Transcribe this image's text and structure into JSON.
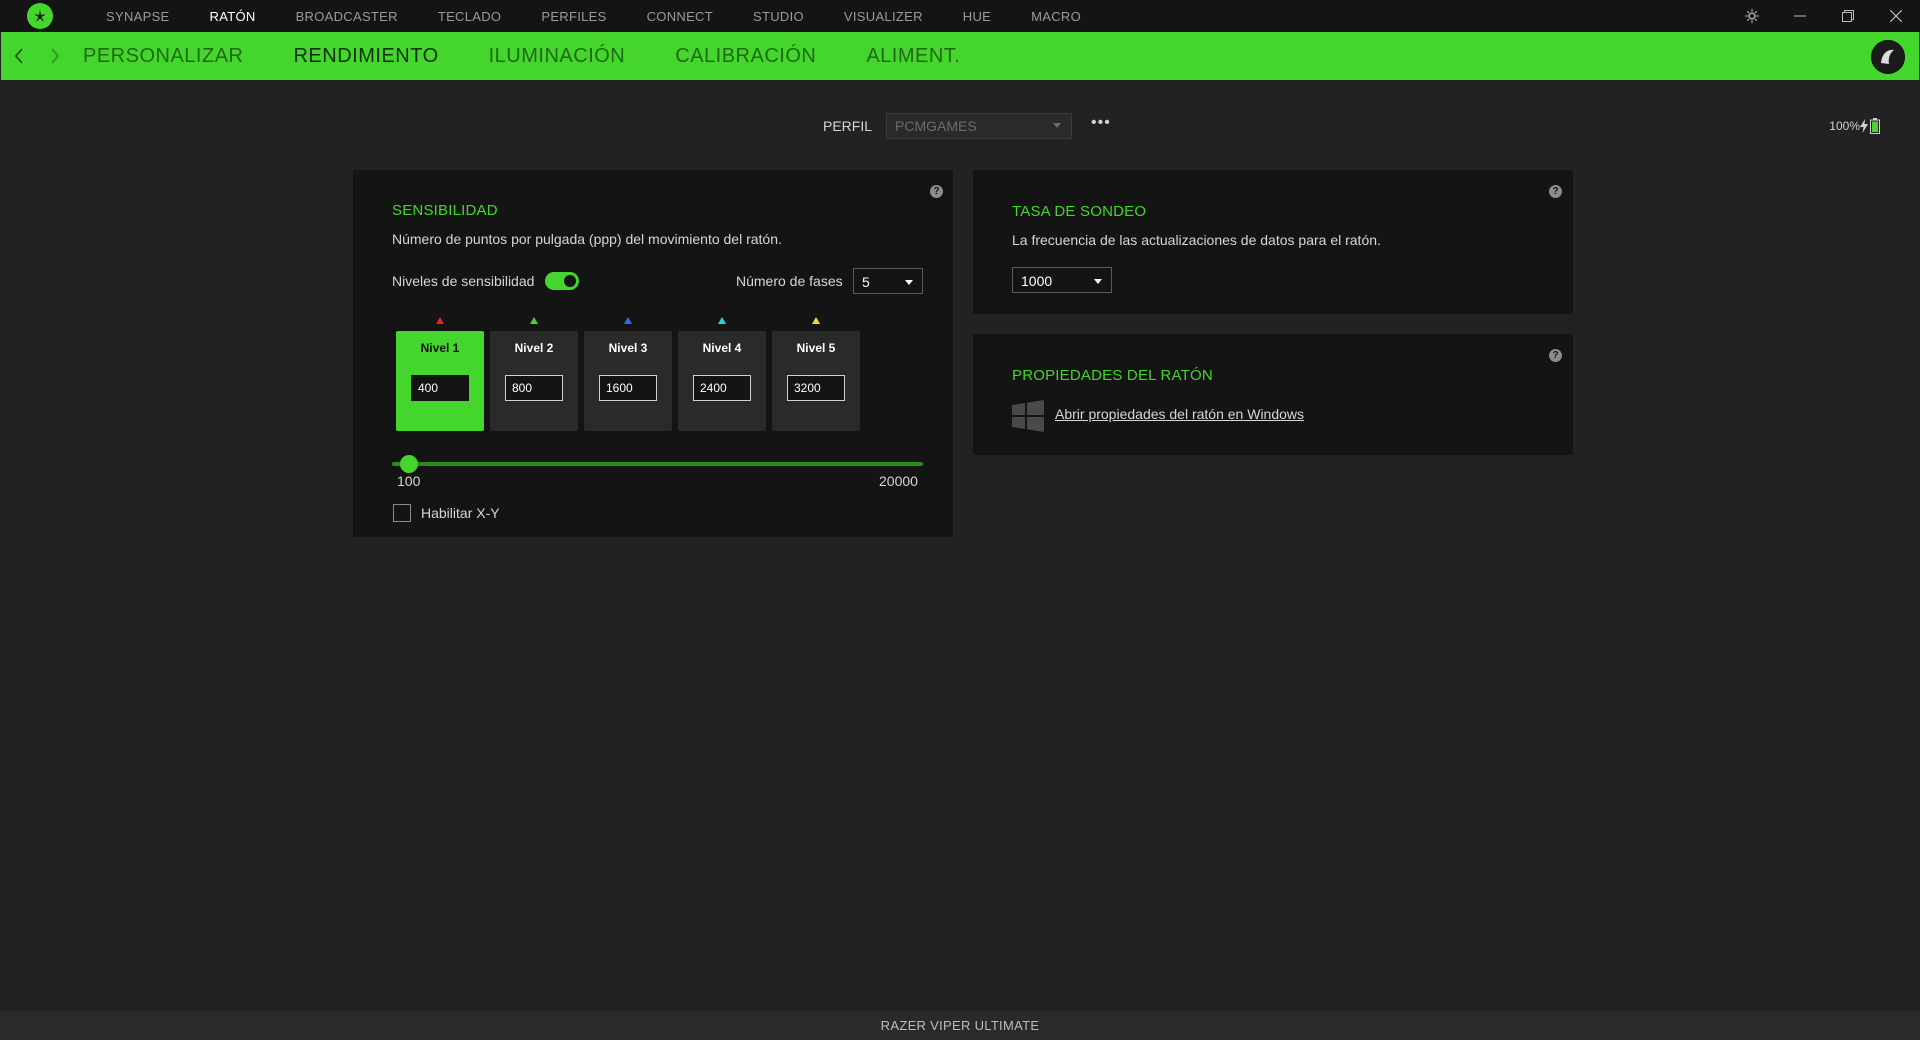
{
  "topnav": {
    "items": [
      "SYNAPSE",
      "RATÓN",
      "BROADCASTER",
      "TECLADO",
      "PERFILES",
      "CONNECT",
      "STUDIO",
      "VISUALIZER",
      "HUE",
      "MACRO"
    ],
    "active": "RATÓN"
  },
  "subnav": {
    "tabs": [
      "PERSONALIZAR",
      "RENDIMIENTO",
      "ILUMINACIÓN",
      "CALIBRACIÓN",
      "ALIMENT."
    ],
    "active": "RENDIMIENTO"
  },
  "profile": {
    "label": "PERFIL",
    "value": "PCMGAMES",
    "more": "•••"
  },
  "battery": {
    "text": "100%",
    "level": 1.0
  },
  "sensitivity": {
    "title": "SENSIBILIDAD",
    "description": "Número de puntos por pulgada (ppp) del movimiento del ratón.",
    "levels_label": "Niveles de sensibilidad",
    "levels_enabled": true,
    "stages_label": "Número de fases",
    "stages_value": "5",
    "levels": [
      {
        "name": "Nivel 1",
        "value": "400",
        "color": "#e0262b",
        "active": true
      },
      {
        "name": "Nivel 2",
        "value": "800",
        "color": "#44d62c",
        "active": false
      },
      {
        "name": "Nivel 3",
        "value": "1600",
        "color": "#2f6fe0",
        "active": false
      },
      {
        "name": "Nivel 4",
        "value": "2400",
        "color": "#2fd0e0",
        "active": false
      },
      {
        "name": "Nivel 5",
        "value": "3200",
        "color": "#e8e02a",
        "active": false
      }
    ],
    "slider_min": "100",
    "slider_max": "20000",
    "xy_label": "Habilitar X-Y",
    "xy_enabled": false
  },
  "polling": {
    "title": "TASA DE SONDEO",
    "description": "La frecuencia de las actualizaciones de datos para el ratón.",
    "value": "1000"
  },
  "mouse_props": {
    "title": "PROPIEDADES DEL RATÓN",
    "link": "Abrir propiedades del ratón en Windows"
  },
  "help_glyph": "?",
  "footer": {
    "device": "RAZER VIPER ULTIMATE"
  },
  "colors": {
    "accent": "#44d62c",
    "background": "#222222",
    "card": "#141414"
  }
}
